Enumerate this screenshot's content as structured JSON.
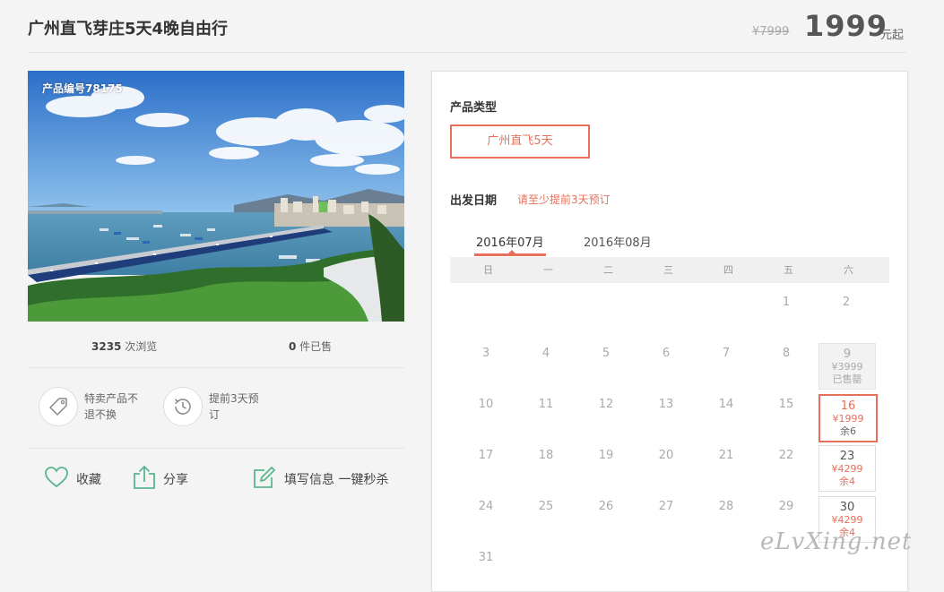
{
  "header": {
    "title": "广州直飞芽庄5天4晚自由行",
    "old_price": "¥7999",
    "price": "1999",
    "price_unit": "元起"
  },
  "photo": {
    "code_label": "产品编号78175"
  },
  "stats": {
    "views_count": "3235",
    "views_label": " 次浏览",
    "sold_count": "0",
    "sold_label": " 件已售"
  },
  "features": [
    {
      "text": "特卖产品不退不换",
      "icon": "price-tag-icon"
    },
    {
      "text": "提前3天预订",
      "icon": "history-clock-icon"
    }
  ],
  "actions": {
    "favorite": "收藏",
    "share": "分享",
    "book": "填写信息 一键秒杀"
  },
  "colors": {
    "accent": "#e8705a",
    "green": "#5bb58f"
  },
  "booking": {
    "type_label": "产品类型",
    "type_option": "广州直飞5天",
    "date_label": "出发日期",
    "date_hint": "请至少提前3天预订",
    "months": [
      "2016年07月",
      "2016年08月"
    ],
    "active_month": 0,
    "weekdays": [
      "日",
      "一",
      "二",
      "三",
      "四",
      "五",
      "六"
    ],
    "days": [
      {
        "d": "1",
        "col": 5,
        "row": 0
      },
      {
        "d": "2",
        "col": 6,
        "row": 0
      },
      {
        "d": "3",
        "col": 0,
        "row": 1
      },
      {
        "d": "4",
        "col": 1,
        "row": 1
      },
      {
        "d": "5",
        "col": 2,
        "row": 1
      },
      {
        "d": "6",
        "col": 3,
        "row": 1
      },
      {
        "d": "7",
        "col": 4,
        "row": 1
      },
      {
        "d": "8",
        "col": 5,
        "row": 1
      },
      {
        "d": "9",
        "col": 6,
        "row": 1,
        "status": "soldout",
        "price": "¥3999",
        "note": "已售罄"
      },
      {
        "d": "10",
        "col": 0,
        "row": 2
      },
      {
        "d": "11",
        "col": 1,
        "row": 2
      },
      {
        "d": "12",
        "col": 2,
        "row": 2
      },
      {
        "d": "13",
        "col": 3,
        "row": 2
      },
      {
        "d": "14",
        "col": 4,
        "row": 2
      },
      {
        "d": "15",
        "col": 5,
        "row": 2
      },
      {
        "d": "16",
        "col": 6,
        "row": 2,
        "status": "selected",
        "price": "¥1999",
        "note": "余6"
      },
      {
        "d": "17",
        "col": 0,
        "row": 3
      },
      {
        "d": "18",
        "col": 1,
        "row": 3
      },
      {
        "d": "19",
        "col": 2,
        "row": 3
      },
      {
        "d": "20",
        "col": 3,
        "row": 3
      },
      {
        "d": "21",
        "col": 4,
        "row": 3
      },
      {
        "d": "22",
        "col": 5,
        "row": 3
      },
      {
        "d": "23",
        "col": 6,
        "row": 3,
        "status": "avail",
        "price": "¥4299",
        "note": "余4"
      },
      {
        "d": "24",
        "col": 0,
        "row": 4
      },
      {
        "d": "25",
        "col": 1,
        "row": 4
      },
      {
        "d": "26",
        "col": 2,
        "row": 4
      },
      {
        "d": "27",
        "col": 3,
        "row": 4
      },
      {
        "d": "28",
        "col": 4,
        "row": 4
      },
      {
        "d": "29",
        "col": 5,
        "row": 4
      },
      {
        "d": "30",
        "col": 6,
        "row": 4,
        "status": "avail",
        "price": "¥4299",
        "note": "余4"
      },
      {
        "d": "31",
        "col": 0,
        "row": 5
      }
    ]
  },
  "watermark": "eLvXing.net"
}
